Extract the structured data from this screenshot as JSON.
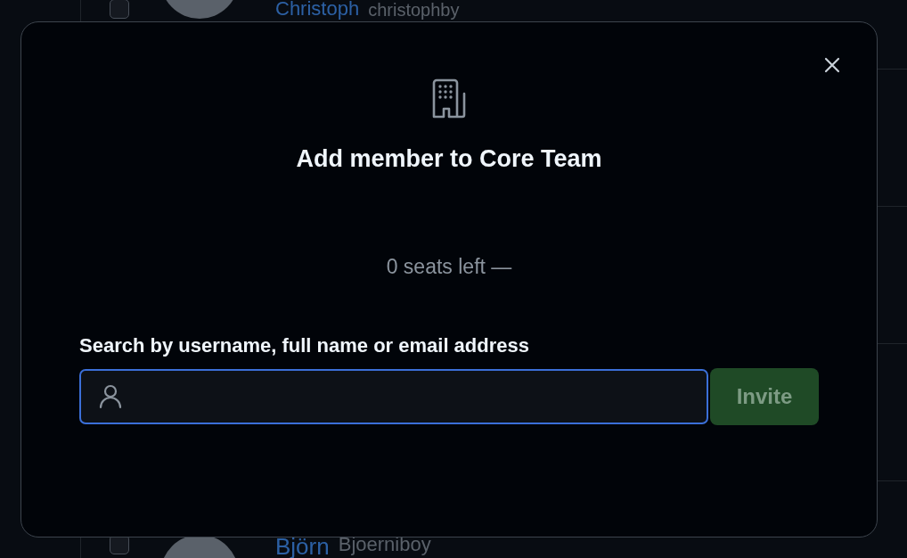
{
  "members": [
    {
      "name": "Christoph",
      "username": "christophby",
      "checked": false
    },
    {
      "name": "Björn",
      "username": "Bjoerniboy",
      "checked": false
    }
  ],
  "dialog": {
    "title": "Add member to Core Team",
    "seats": "0 seats left —",
    "search_label": "Search by username, full name or email address",
    "search_field": {
      "focused": true
    },
    "invite_button": {
      "label": "Invite",
      "disabled": true
    }
  }
}
